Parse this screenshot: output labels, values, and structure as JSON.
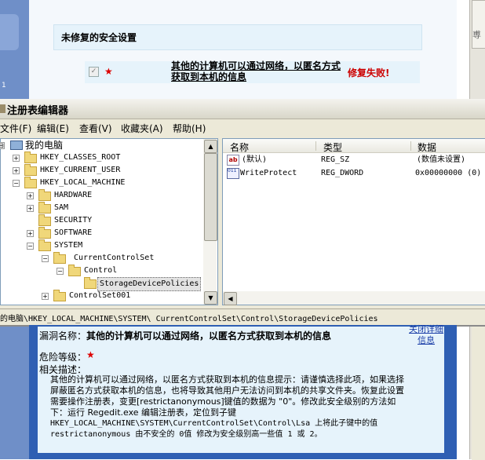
{
  "background_app": {
    "left_number": "1",
    "right_glyph": "尃",
    "unfixed_title": "未修复的安全设置",
    "row_text": "其他的计算机可以通过网络，以匿名方式获取到本机的信息",
    "row_status": "修复失败!",
    "star": "★",
    "check": "✓"
  },
  "regedit": {
    "title": "注册表编辑器",
    "menus": [
      "文件(F)",
      "编辑(E)",
      "查看(V)",
      "收藏夹(A)",
      "帮助(H)"
    ],
    "tree": [
      {
        "label": "我的电脑",
        "toggle": "⊟",
        "icon": "computer-icon"
      },
      {
        "label": "HKEY_CLASSES_ROOT",
        "toggle": "+",
        "icon": "folder-icon"
      },
      {
        "label": "HKEY_CURRENT_USER",
        "toggle": "+",
        "icon": "folder-icon"
      },
      {
        "label": "HKEY_LOCAL_MACHINE",
        "toggle": "−",
        "icon": "folder-icon"
      },
      {
        "label": "HARDWARE",
        "toggle": "+",
        "icon": "folder-icon"
      },
      {
        "label": "SAM",
        "toggle": "+",
        "icon": "folder-icon"
      },
      {
        "label": "SECURITY",
        "toggle": "",
        "icon": "folder-icon"
      },
      {
        "label": "SOFTWARE",
        "toggle": "+",
        "icon": "folder-icon"
      },
      {
        "label": "SYSTEM",
        "toggle": "−",
        "icon": "folder-icon"
      },
      {
        "label": "CurrentControlSet",
        "toggle": "−",
        "icon": "folder-icon"
      },
      {
        "label": "Control",
        "toggle": "−",
        "icon": "folder-icon"
      },
      {
        "label": "StorageDevicePolicies",
        "toggle": "",
        "icon": "open-folder-icon",
        "selected": true
      },
      {
        "label": "ControlSet001",
        "toggle": "+",
        "icon": "folder-icon"
      }
    ],
    "list_columns": [
      "名称",
      "类型",
      "数据"
    ],
    "list_rows": [
      {
        "name": "(默认)",
        "type": "REG_SZ",
        "data": "(数值未设置)",
        "icon": "string-value-icon",
        "icon_text": "ab"
      },
      {
        "name": "WriteProtect",
        "type": "REG_DWORD",
        "data": "0x00000000 (0)",
        "icon": "binary-value-icon",
        "icon_text": "011 110"
      }
    ],
    "status_path": "的电脑\\HKEY_LOCAL_MACHINE\\SYSTEM\\ CurrentControlSet\\Control\\StorageDevicePolicies"
  },
  "detail": {
    "vuln_label": "漏洞名称：",
    "vuln_name": "其他的计算机可以通过网络，以匿名方式获取到本机的信息",
    "close_link": "关闭详细信息",
    "danger_label": "危险等级：",
    "danger_star": "★",
    "desc_label": "相关描述：",
    "desc_line1": "其他的计算机可以通过网络，以匿名方式获取到本机的信息提示：请谨慎选择此项，如果选择",
    "desc_line2": "屏蔽匿名方式获取本机的信息，也将导致其他用户无法访问到本机的共享文件夹。恢复此设置",
    "desc_line3": "需要操作注册表，变更[restrictanonymous]键值的数据为 \"0\"。修改此安全级别的方法如",
    "desc_line4": "下：运行 Regedit.exe 编辑注册表，定位到子键",
    "desc_line5": "HKEY_LOCAL_MACHINE\\SYSTEM\\CurrentControlSet\\Control\\Lsa 上将此子键中的值",
    "desc_line6": "restrictanonymous 由不安全的 0值 修改为安全级别高一些值 1 或 2。"
  }
}
